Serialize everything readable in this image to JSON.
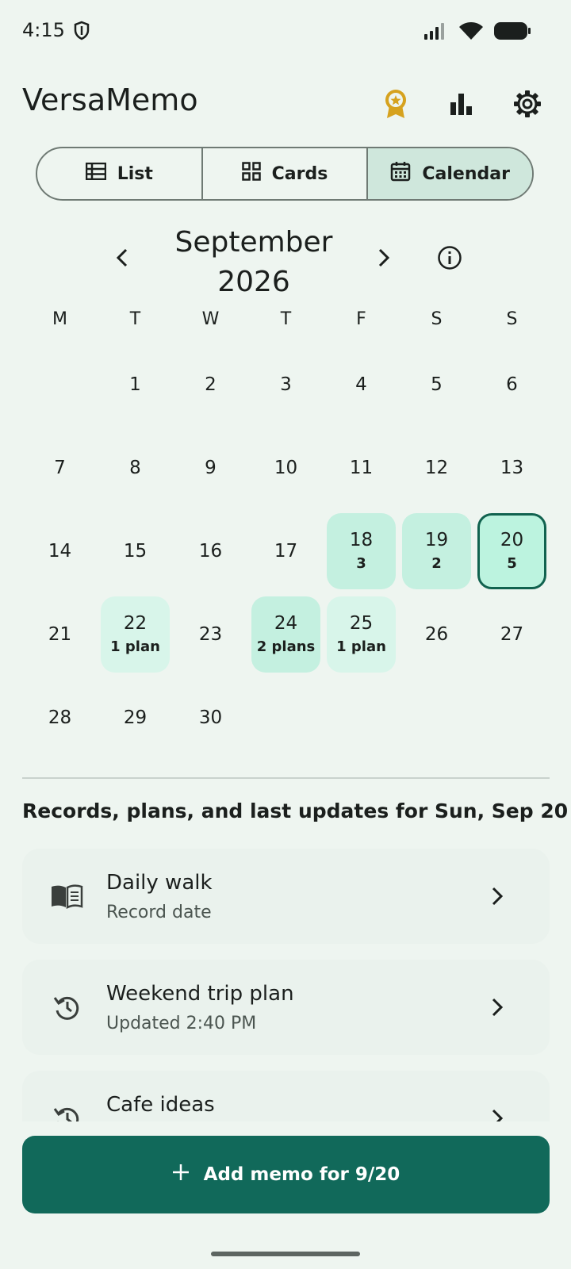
{
  "status_bar": {
    "time": "4:15"
  },
  "app": {
    "title": "VersaMemo"
  },
  "view_tabs": [
    {
      "label": "List",
      "icon": "list-icon",
      "active": false
    },
    {
      "label": "Cards",
      "icon": "grid-icon",
      "active": false
    },
    {
      "label": "Calendar",
      "icon": "calendar-icon",
      "active": true
    }
  ],
  "calendar": {
    "month_line1": "September",
    "month_line2": "2026",
    "weekdays": [
      "M",
      "T",
      "W",
      "T",
      "F",
      "S",
      "S"
    ],
    "weeks": [
      [
        {
          "day": ""
        },
        {
          "day": "1"
        },
        {
          "day": "2"
        },
        {
          "day": "3"
        },
        {
          "day": "4"
        },
        {
          "day": "5"
        },
        {
          "day": "6"
        }
      ],
      [
        {
          "day": "7"
        },
        {
          "day": "8"
        },
        {
          "day": "9"
        },
        {
          "day": "10"
        },
        {
          "day": "11"
        },
        {
          "day": "12"
        },
        {
          "day": "13"
        }
      ],
      [
        {
          "day": "14"
        },
        {
          "day": "15"
        },
        {
          "day": "16"
        },
        {
          "day": "17"
        },
        {
          "day": "18",
          "count": "3",
          "level": 2
        },
        {
          "day": "19",
          "count": "2",
          "level": 2
        },
        {
          "day": "20",
          "count": "5",
          "level": 3,
          "selected": true
        }
      ],
      [
        {
          "day": "21"
        },
        {
          "day": "22",
          "count": "1 plan",
          "level": 1
        },
        {
          "day": "23"
        },
        {
          "day": "24",
          "count": "2 plans",
          "level": 2
        },
        {
          "day": "25",
          "count": "1 plan",
          "level": 1
        },
        {
          "day": "26"
        },
        {
          "day": "27"
        }
      ],
      [
        {
          "day": "28"
        },
        {
          "day": "29"
        },
        {
          "day": "30"
        },
        {
          "day": ""
        },
        {
          "day": ""
        },
        {
          "day": ""
        },
        {
          "day": ""
        }
      ]
    ]
  },
  "section": {
    "title": "Records, plans, and last updates for Sun, Sep 20"
  },
  "memos": [
    {
      "title": "Daily walk",
      "subtitle": "Record date",
      "icon": "book-icon"
    },
    {
      "title": "Weekend trip plan",
      "subtitle": "Updated 2:40 PM",
      "icon": "history-icon"
    },
    {
      "title": "Cafe ideas",
      "subtitle": "",
      "icon": "history-icon"
    }
  ],
  "add_button": {
    "label": "Add memo for 9/20"
  },
  "colors": {
    "accent": "#11695a",
    "selected_border": "#11624f",
    "highlight": "#c4f0e0",
    "award": "#d6a21e"
  }
}
